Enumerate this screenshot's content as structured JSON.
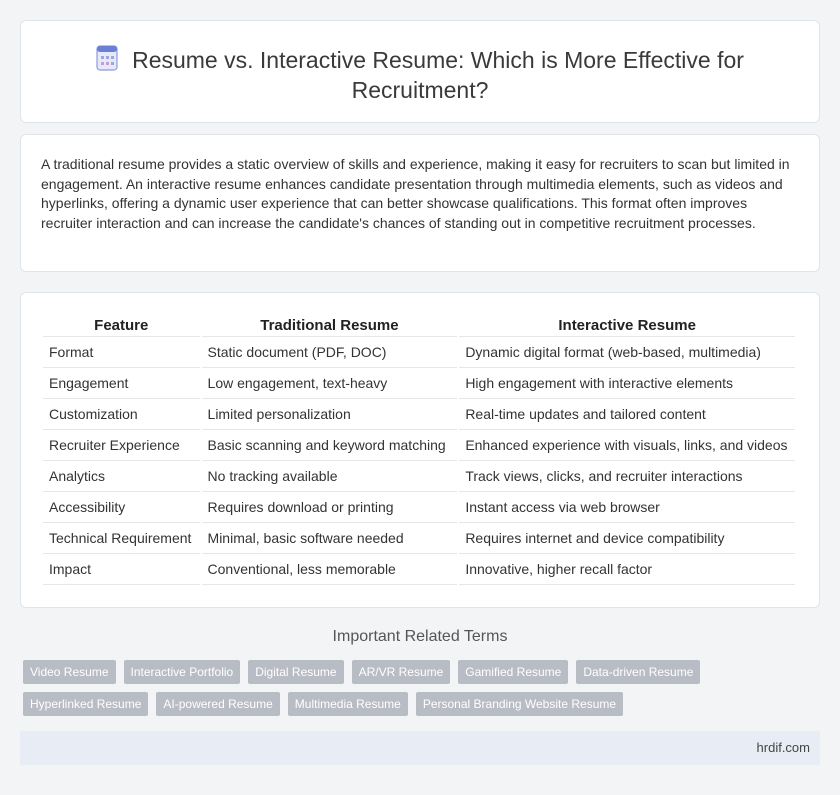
{
  "header": {
    "title_line1": "Resume vs. Interactive Resume: Which is More Effective for",
    "title_line2": "Recruitment?"
  },
  "intro": {
    "text": "A traditional resume provides a static overview of skills and experience, making it easy for recruiters to scan but limited in engagement. An interactive resume enhances candidate presentation through multimedia elements, such as videos and hyperlinks, offering a dynamic user experience that can better showcase qualifications. This format often improves recruiter interaction and can increase the candidate's chances of standing out in competitive recruitment processes."
  },
  "table": {
    "headers": [
      "Feature",
      "Traditional Resume",
      "Interactive Resume"
    ],
    "rows": [
      [
        "Format",
        "Static document (PDF, DOC)",
        "Dynamic digital format (web-based, multimedia)"
      ],
      [
        "Engagement",
        "Low engagement, text-heavy",
        "High engagement with interactive elements"
      ],
      [
        "Customization",
        "Limited personalization",
        "Real-time updates and tailored content"
      ],
      [
        "Recruiter Experience",
        "Basic scanning and keyword matching",
        "Enhanced experience with visuals, links, and videos"
      ],
      [
        "Analytics",
        "No tracking available",
        "Track views, clicks, and recruiter interactions"
      ],
      [
        "Accessibility",
        "Requires download or printing",
        "Instant access via web browser"
      ],
      [
        "Technical Requirement",
        "Minimal, basic software needed",
        "Requires internet and device compatibility"
      ],
      [
        "Impact",
        "Conventional, less memorable",
        "Innovative, higher recall factor"
      ]
    ]
  },
  "related": {
    "title": "Important Related Terms",
    "tags_row1": [
      "Video Resume",
      "Interactive Portfolio",
      "Digital Resume",
      "AR/VR Resume",
      "Gamified Resume",
      "Data-driven Resume"
    ],
    "tags_row2": [
      "Hyperlinked Resume",
      "AI-powered Resume",
      "Multimedia Resume",
      "Personal Branding Website Resume"
    ]
  },
  "footer": {
    "site": "hrdif.com"
  },
  "icons": {
    "title_icon": "document-icon"
  },
  "colors": {
    "tag_bg": "#b8bcc4",
    "footer_bg": "#e8edf5",
    "icon_accent": "#6b7fd7"
  }
}
